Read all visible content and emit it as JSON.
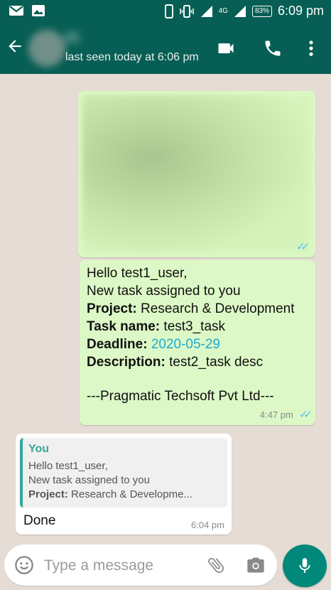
{
  "status_bar": {
    "time": "6:09 pm",
    "battery": "83%",
    "network": "4G",
    "icons": [
      "gmail-icon",
      "gallery-icon",
      "phone-icon",
      "vibrate-icon",
      "signal-icon",
      "signal-icon"
    ]
  },
  "header": {
    "contact_name": "Pi",
    "last_seen": "last seen today at 6:06 pm",
    "icons": [
      "back-arrow-icon",
      "video-call-icon",
      "phone-call-icon",
      "more-vert-icon"
    ],
    "color": "#075e54"
  },
  "messages": {
    "image_message": {
      "content": "blurred image",
      "ticks": "double-check-icon"
    },
    "task_message": {
      "greeting": "Hello test1_user,",
      "intro": "New task assigned to you",
      "project_label": "Project:",
      "project_value": "Research & Development",
      "task_label": "Task name:",
      "task_value": "test3_task",
      "deadline_label": "Deadline:",
      "deadline_value": "2020-05-29",
      "description_label": "Description:",
      "description_value": "test2_task desc",
      "signature": "---Pragmatic Techsoft Pvt Ltd---",
      "time": "4:47 pm"
    },
    "reply_message": {
      "quote_author": "You",
      "quote_line1": "Hello test1_user,",
      "quote_line2": "New task assigned to you",
      "quote_project_label": "Project:",
      "quote_project_value": "Research & Developme...",
      "text": "Done",
      "time": "6:04 pm"
    }
  },
  "input_bar": {
    "placeholder": "Type a message",
    "value": ""
  },
  "colors": {
    "sent_bubble": "#dcf8c6",
    "received_bubble": "#ffffff",
    "accent": "#00897b",
    "link": "#1eaad1",
    "read_ticks": "#4fc3f7"
  }
}
